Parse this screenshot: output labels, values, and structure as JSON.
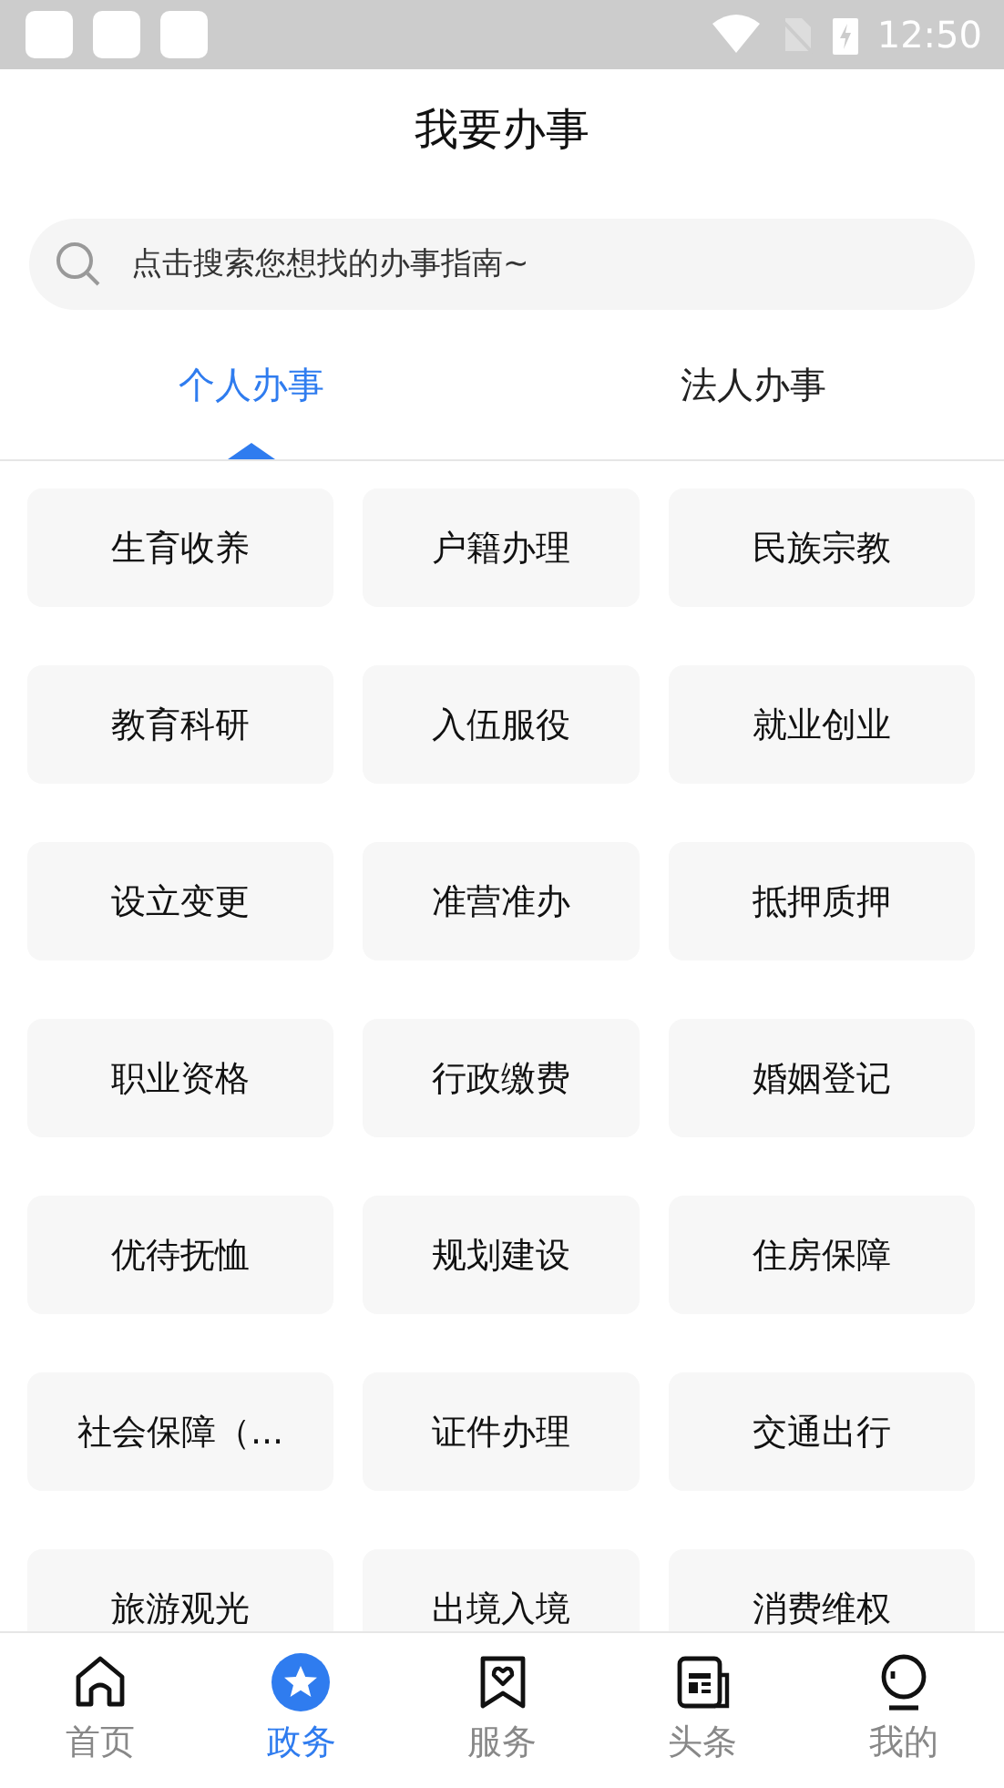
{
  "status_bar": {
    "time": "12:50"
  },
  "title": "我要办事",
  "search": {
    "placeholder": "点击搜索您想找的办事指南~"
  },
  "tabs": [
    {
      "label": "个人办事",
      "selected": true
    },
    {
      "label": "法人办事",
      "selected": false
    }
  ],
  "services": [
    "生育收养",
    "户籍办理",
    "民族宗教",
    "教育科研",
    "入伍服役",
    "就业创业",
    "设立变更",
    "准营准办",
    "抵押质押",
    "职业资格",
    "行政缴费",
    "婚姻登记",
    "优待抚恤",
    "规划建设",
    "住房保障",
    "社会保障（...",
    "证件办理",
    "交通出行",
    "旅游观光",
    "出境入境",
    "消费维权"
  ],
  "nav": [
    {
      "label": "首页",
      "kind": "home",
      "selected": false
    },
    {
      "label": "政务",
      "kind": "star",
      "selected": true
    },
    {
      "label": "服务",
      "kind": "heart",
      "selected": false
    },
    {
      "label": "头条",
      "kind": "news",
      "selected": false
    },
    {
      "label": "我的",
      "kind": "person",
      "selected": false
    }
  ]
}
